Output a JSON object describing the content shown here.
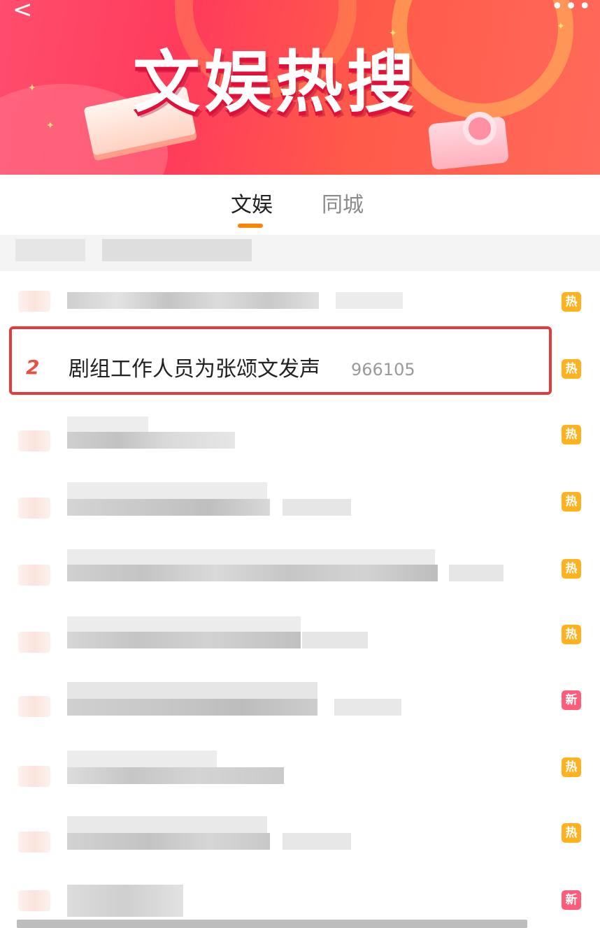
{
  "banner": {
    "title": "文娱热搜",
    "back_glyph": "<",
    "more_glyph": "•••",
    "back_icon": "back-chevron-icon",
    "more_icon": "more-dots-icon"
  },
  "tabs": [
    {
      "label": "文娱",
      "active": true
    },
    {
      "label": "同城",
      "active": false
    }
  ],
  "highlighted_row": {
    "rank": "2",
    "title": "剧组工作人员为张颂文发声",
    "count": "966105",
    "badge": "热"
  },
  "rows": [
    {
      "badge": "热",
      "badge_type": "hot"
    },
    {
      "badge": "热",
      "badge_type": "hot"
    },
    {
      "badge": "热",
      "badge_type": "hot"
    },
    {
      "badge": "热",
      "badge_type": "hot"
    },
    {
      "badge": "热",
      "badge_type": "hot"
    },
    {
      "badge": "热",
      "badge_type": "hot"
    },
    {
      "badge": "新",
      "badge_type": "new"
    },
    {
      "badge": "热",
      "badge_type": "hot"
    },
    {
      "badge": "热",
      "badge_type": "hot"
    },
    {
      "badge": "新",
      "badge_type": "new"
    }
  ],
  "colors": {
    "accent": "#ff8200",
    "hot_badge": "#ffb21e",
    "new_badge": "#ff5c7a",
    "highlight_border": "#e53a3a",
    "rank_color": "#e8513f"
  }
}
